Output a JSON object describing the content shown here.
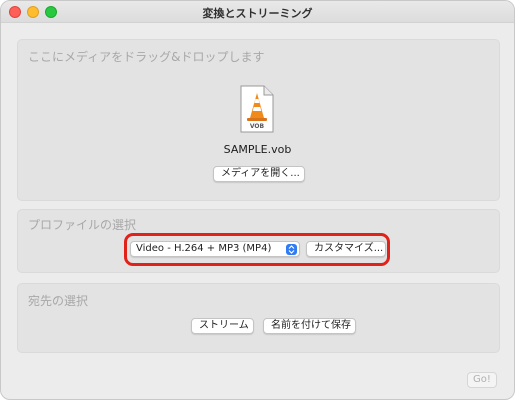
{
  "window": {
    "title": "変換とストリーミング"
  },
  "media": {
    "drop_label": "ここにメディアをドラッグ&ドロップします",
    "file_icon_label": "VOB",
    "file_name": "SAMPLE.vob",
    "open_button": "メディアを開く..."
  },
  "profile": {
    "label": "プロファイルの選択",
    "selected": "Video - H.264 + MP3 (MP4)",
    "customize_button": "カスタマイズ..."
  },
  "destination": {
    "label": "宛先の選択",
    "stream_button": "ストリーム",
    "save_button": "名前を付けて保存"
  },
  "footer": {
    "go_button": "Go!"
  },
  "colors": {
    "highlight": "#e0221b",
    "accent": "#2f7cf6",
    "cone_orange": "#f08a1c"
  }
}
